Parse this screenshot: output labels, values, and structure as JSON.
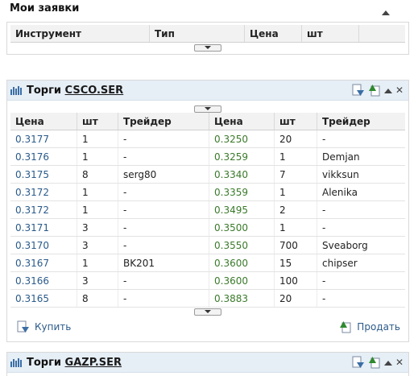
{
  "orders_panel": {
    "title": "Мои заявки",
    "columns": [
      "Инструмент",
      "Тип",
      "Цена",
      "шт"
    ]
  },
  "trades_panel": {
    "title_prefix": "Торги",
    "ticker": "CSCO.SER",
    "columns": [
      "Цена",
      "шт",
      "Трейдер",
      "Цена",
      "шт",
      "Трейдер"
    ],
    "rows": [
      {
        "bp": "0.3177",
        "bq": "1",
        "bt": "-",
        "sp": "0.3250",
        "sq": "20",
        "st": "-"
      },
      {
        "bp": "0.3176",
        "bq": "1",
        "bt": "-",
        "sp": "0.3259",
        "sq": "1",
        "st": "Demjan"
      },
      {
        "bp": "0.3175",
        "bq": "8",
        "bt": "serg80",
        "sp": "0.3340",
        "sq": "7",
        "st": "vikksun"
      },
      {
        "bp": "0.3172",
        "bq": "1",
        "bt": "-",
        "sp": "0.3359",
        "sq": "1",
        "st": "Alenika"
      },
      {
        "bp": "0.3172",
        "bq": "1",
        "bt": "-",
        "sp": "0.3495",
        "sq": "2",
        "st": "-"
      },
      {
        "bp": "0.3171",
        "bq": "3",
        "bt": "-",
        "sp": "0.3500",
        "sq": "1",
        "st": "-"
      },
      {
        "bp": "0.3170",
        "bq": "3",
        "bt": "-",
        "sp": "0.3550",
        "sq": "700",
        "st": "Sveaborg"
      },
      {
        "bp": "0.3167",
        "bq": "1",
        "bt": "BK201",
        "sp": "0.3600",
        "sq": "15",
        "st": "chipser"
      },
      {
        "bp": "0.3166",
        "bq": "3",
        "bt": "-",
        "sp": "0.3600",
        "sq": "100",
        "st": "-"
      },
      {
        "bp": "0.3165",
        "bq": "8",
        "bt": "-",
        "sp": "0.3883",
        "sq": "20",
        "st": "-"
      }
    ],
    "buy_label": "Купить",
    "sell_label": "Продать"
  },
  "trades_panel_2": {
    "title_prefix": "Торги",
    "ticker": "GAZP.SER"
  },
  "colors": {
    "header_bg": "#e6eef6",
    "buy_price": "#2a5a8a",
    "sell_price": "#3a7a2a"
  }
}
